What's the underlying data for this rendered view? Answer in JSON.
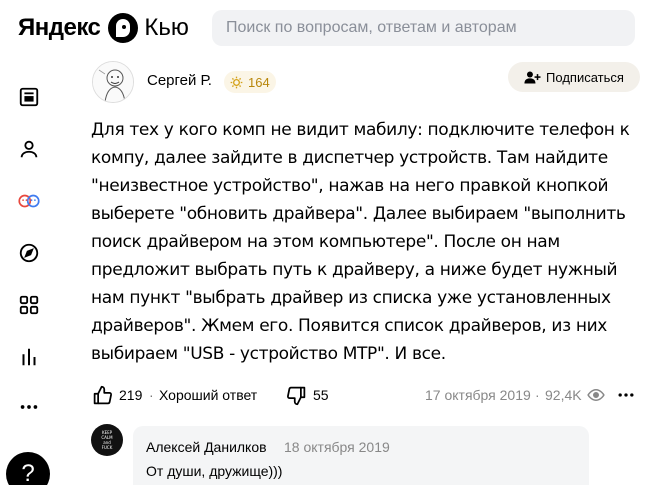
{
  "header": {
    "logo_yandex": "Яндекс",
    "logo_kyu": "Кью",
    "search_placeholder": "Поиск по вопросам, ответам и авторам"
  },
  "sidebar": {
    "items": [
      {
        "name": "feed",
        "icon": "feed-icon"
      },
      {
        "name": "profile",
        "icon": "user-icon"
      },
      {
        "name": "communities",
        "icon": "communities-icon"
      },
      {
        "name": "explore",
        "icon": "compass-icon"
      },
      {
        "name": "categories",
        "icon": "grid-icon"
      },
      {
        "name": "stats",
        "icon": "bars-icon"
      },
      {
        "name": "more",
        "icon": "more-icon"
      }
    ],
    "help_label": "?"
  },
  "answer": {
    "author": "Сергей Р.",
    "rating": "164",
    "subscribe_label": "Подписаться",
    "text": "Для тех у кого комп не видит мабилу: подключите телефон к компу, далее зайдите в диспетчер устройств. Там найдите \"неизвестное устройство\", нажав на него правкой кнопкой выберете \"обновить драйвера\". Далее выбираем \"выполнить поиск драйвером на этом компьютере\". После он нам предложит выбрать путь к драйверу, а ниже будет нужный нам пункт \"выбрать драйвер из списка уже установленных драйверов\". Жмем его. Появится список драйверов, из них выбираем \"USB - устройство MTP\". И все.",
    "likes": "219",
    "good_answer_label": "Хороший ответ",
    "dislikes": "55",
    "date": "17 октября 2019",
    "views": "92,4K",
    "separator": "·"
  },
  "comment": {
    "author": "Алексей Данилков",
    "date": "18 октября 2019",
    "text": "От души, дружище)))",
    "avatar_text": [
      "KEEP",
      "CALM",
      "and",
      "FUCK"
    ]
  },
  "colors": {
    "rating_bg": "#fbf5e6",
    "rating_text": "#b8860b",
    "search_bg": "#f1f2f4",
    "comment_bg": "#f4f5f6"
  }
}
